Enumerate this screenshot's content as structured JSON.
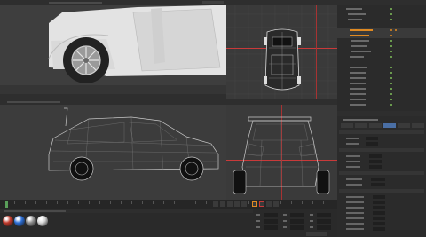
{
  "app": {
    "title": ""
  },
  "menus": {
    "top_left": [],
    "top_right": []
  },
  "viewports": {
    "perspective": {
      "label": ""
    },
    "top": {
      "label": ""
    },
    "right": {
      "label": ""
    },
    "front": {
      "label": ""
    }
  },
  "object_manager": {
    "items": []
  },
  "attributes": {
    "tabs": [],
    "fields": []
  },
  "timeline": {
    "frame": ""
  },
  "material_manager": {
    "materials": [
      {
        "name": "",
        "color": "#c0392b"
      },
      {
        "name": "",
        "color": "#2d6fd6"
      },
      {
        "name": "",
        "color": "#8f8f8f"
      },
      {
        "name": "",
        "color": "#d8d8d8"
      }
    ]
  },
  "coordinates": {
    "fields": []
  },
  "colors": {
    "bg": "#1c1c1c",
    "panel": "#2a2a2a",
    "viewport": "#3c3c3c",
    "guide": "#c93a3a",
    "active": "#e08a22"
  }
}
